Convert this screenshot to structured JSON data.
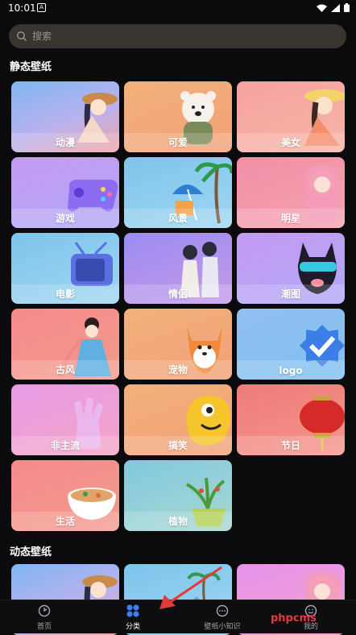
{
  "status_bar": {
    "time": "10:01",
    "notification_icon": "A"
  },
  "search": {
    "placeholder": "搜索"
  },
  "static_section": {
    "title": "静态壁纸",
    "categories": [
      {
        "label": "动漫",
        "theme": "blue",
        "icon": "anime-girl-hat"
      },
      {
        "label": "可爱",
        "theme": "orange",
        "icon": "polar-bear"
      },
      {
        "label": "美女",
        "theme": "pink",
        "icon": "girl-sunhat"
      },
      {
        "label": "游戏",
        "theme": "purple",
        "icon": "gamepad"
      },
      {
        "label": "风景",
        "theme": "sky",
        "icon": "beach-umbrella-palm"
      },
      {
        "label": "明星",
        "theme": "rose",
        "icon": "pink-hair-girl"
      },
      {
        "label": "电影",
        "theme": "sky",
        "icon": "retro-tv"
      },
      {
        "label": "情侣",
        "theme": "violet",
        "icon": "couple"
      },
      {
        "label": "潮图",
        "theme": "purple",
        "icon": "dog-sunglasses"
      },
      {
        "label": "古风",
        "theme": "salmon",
        "icon": "ancient-girl"
      },
      {
        "label": "宠物",
        "theme": "orange",
        "icon": "corgi"
      },
      {
        "label": "logo",
        "theme": "lightblue",
        "icon": "verified-badge"
      },
      {
        "label": "非主流",
        "theme": "magenta",
        "icon": "rock-hand"
      },
      {
        "label": "搞笑",
        "theme": "orange",
        "icon": "yellow-blob"
      },
      {
        "label": "节日",
        "theme": "redsalmon",
        "icon": "red-lantern"
      },
      {
        "label": "生活",
        "theme": "salmon",
        "icon": "noodle-bowl"
      },
      {
        "label": "植物",
        "theme": "teal",
        "icon": "plant-pot"
      }
    ]
  },
  "dynamic_section": {
    "title": "动态壁纸",
    "tiles": [
      {
        "theme": "blue",
        "icon": "anime-girl-hat"
      },
      {
        "theme": "sky",
        "icon": "landscape"
      },
      {
        "theme": "lilac",
        "icon": "pink-hair-girl"
      }
    ]
  },
  "bottom_nav": {
    "items": [
      {
        "label": "首页",
        "icon": "home-icon",
        "active": false
      },
      {
        "label": "分类",
        "icon": "category-icon",
        "active": true
      },
      {
        "label": "壁纸小知识",
        "icon": "chat-bubble-icon",
        "active": false
      },
      {
        "label": "我的",
        "icon": "smiley-icon",
        "active": false
      }
    ]
  },
  "watermark": "phpcms"
}
